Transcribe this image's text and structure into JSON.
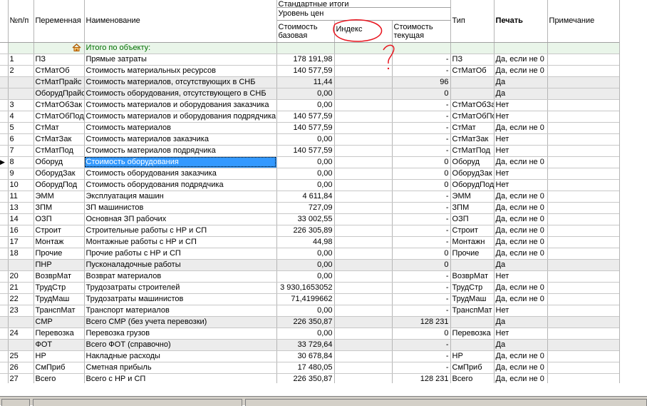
{
  "header": {
    "col_num": "№п/п",
    "col_var": "Переменная",
    "col_name": "Наименование",
    "group_standard": "Стандартные итоги",
    "group_price_level": "Уровень цен",
    "col_base_cost": "Стоимость базовая",
    "col_index": "Индекс",
    "col_current_cost": "Стоимость текущая",
    "col_type": "Тип",
    "col_print": "Печать",
    "col_note": "Примечание"
  },
  "total_row": {
    "label": "Итого по объекту:"
  },
  "rows": [
    {
      "n": "1",
      "var": "ПЗ",
      "name": "Прямые затраты",
      "base": "178 191,98",
      "index": "",
      "cur": "-",
      "type": "ПЗ",
      "print": "Да, если не 0",
      "alt": false
    },
    {
      "n": "2",
      "var": "СтМатОб",
      "name": "Стоимость материальных ресурсов",
      "base": "140 577,59",
      "index": "",
      "cur": "-",
      "type": "СтМатОб",
      "print": "Да, если не 0",
      "alt": false
    },
    {
      "n": "",
      "var": "СтМатПрайс",
      "name": "Стоимость материалов, отсутствующих в СНБ",
      "base": "11,44",
      "index": "",
      "cur": "96",
      "type": "",
      "print": "Да",
      "alt": true
    },
    {
      "n": "",
      "var": "ОборудПрайс",
      "name": "Стоимость оборудования, отсутствующего в СНБ",
      "base": "0,00",
      "index": "",
      "cur": "0",
      "type": "",
      "print": "Да",
      "alt": true
    },
    {
      "n": "3",
      "var": "СтМатОбЗак",
      "name": "Стоимость материалов и оборудования заказчика",
      "base": "0,00",
      "index": "",
      "cur": "-",
      "type": "СтМатОбЗа",
      "print": "Нет",
      "alt": false
    },
    {
      "n": "4",
      "var": "СтМатОбПод",
      "name": "Стоимость материалов и оборудования подрядчика",
      "base": "140 577,59",
      "index": "",
      "cur": "-",
      "type": "СтМатОбПо",
      "print": "Нет",
      "alt": false
    },
    {
      "n": "5",
      "var": "СтМат",
      "name": "Стоимость материалов",
      "base": "140 577,59",
      "index": "",
      "cur": "-",
      "type": "СтМат",
      "print": "Да, если не 0",
      "alt": false
    },
    {
      "n": "6",
      "var": "СтМатЗак",
      "name": "Стоимость материалов заказчика",
      "base": "0,00",
      "index": "",
      "cur": "-",
      "type": "СтМатЗак",
      "print": "Нет",
      "alt": false
    },
    {
      "n": "7",
      "var": "СтМатПод",
      "name": "Стоимость материалов подрядчика",
      "base": "140 577,59",
      "index": "",
      "cur": "-",
      "type": "СтМатПод",
      "print": "Нет",
      "alt": false
    },
    {
      "n": "8",
      "var": "Оборуд",
      "name": "Стоимость оборудования",
      "base": "0,00",
      "index": "",
      "cur": "0",
      "type": "Оборуд",
      "print": "Да, если не 0",
      "alt": false,
      "selected": true
    },
    {
      "n": "9",
      "var": "ОборудЗак",
      "name": "Стоимость оборудования заказчика",
      "base": "0,00",
      "index": "",
      "cur": "0",
      "type": "ОборудЗак",
      "print": "Нет",
      "alt": false
    },
    {
      "n": "10",
      "var": "ОборудПод",
      "name": "Стоимость оборудования подрядчика",
      "base": "0,00",
      "index": "",
      "cur": "0",
      "type": "ОборудПод",
      "print": "Нет",
      "alt": false
    },
    {
      "n": "11",
      "var": "ЭММ",
      "name": "Эксплуатация машин",
      "base": "4 611,84",
      "index": "",
      "cur": "-",
      "type": "ЭММ",
      "print": "Да, если не 0",
      "alt": false
    },
    {
      "n": "13",
      "var": "ЗПМ",
      "name": "ЗП машинистов",
      "base": "727,09",
      "index": "",
      "cur": "-",
      "type": "ЗПМ",
      "print": "Да, если не 0",
      "alt": false
    },
    {
      "n": "14",
      "var": "ОЗП",
      "name": "Основная ЗП рабочих",
      "base": "33 002,55",
      "index": "",
      "cur": "-",
      "type": "ОЗП",
      "print": "Да, если не 0",
      "alt": false
    },
    {
      "n": "16",
      "var": "Строит",
      "name": "Строительные работы с НР и СП",
      "base": "226 305,89",
      "index": "",
      "cur": "-",
      "type": "Строит",
      "print": "Да, если не 0",
      "alt": false
    },
    {
      "n": "17",
      "var": "Монтаж",
      "name": "Монтажные работы с НР и СП",
      "base": "44,98",
      "index": "",
      "cur": "-",
      "type": "Монтажн",
      "print": "Да, если не 0",
      "alt": false
    },
    {
      "n": "18",
      "var": "Прочие",
      "name": "Прочие работы с НР и СП",
      "base": "0,00",
      "index": "",
      "cur": "0",
      "type": "Прочие",
      "print": "Да, если не 0",
      "alt": false
    },
    {
      "n": "",
      "var": "ПНР",
      "name": "Пусконаладочные работы",
      "base": "0,00",
      "index": "",
      "cur": "0",
      "type": "",
      "print": "Да",
      "alt": true
    },
    {
      "n": "20",
      "var": "ВозврМат",
      "name": "Возврат материалов",
      "base": "0,00",
      "index": "",
      "cur": "-",
      "type": "ВозврМат",
      "print": "Нет",
      "alt": false
    },
    {
      "n": "21",
      "var": "ТрудСтр",
      "name": "Трудозатраты строителей",
      "base": "3 930,1653052",
      "index": "",
      "cur": "-",
      "type": "ТрудСтр",
      "print": "Да, если не 0",
      "alt": false
    },
    {
      "n": "22",
      "var": "ТрудМаш",
      "name": "Трудозатраты машинистов",
      "base": "71,4199662",
      "index": "",
      "cur": "-",
      "type": "ТрудМаш",
      "print": "Да, если не 0",
      "alt": false
    },
    {
      "n": "23",
      "var": "ТранспМат",
      "name": "Транспорт материалов",
      "base": "0,00",
      "index": "",
      "cur": "-",
      "type": "ТранспМат",
      "print": "Нет",
      "alt": false
    },
    {
      "n": "",
      "var": "СМР",
      "name": "Всего СМР (без учета перевозки)",
      "base": "226 350,87",
      "index": "",
      "cur": "128 231",
      "type": "",
      "print": "Да",
      "alt": true
    },
    {
      "n": "24",
      "var": "Перевозка",
      "name": "Перевозка грузов",
      "base": "0,00",
      "index": "",
      "cur": "0",
      "type": "Перевозка",
      "print": "Нет",
      "alt": false
    },
    {
      "n": "",
      "var": "ФОТ",
      "name": "Всего ФОТ (справочно)",
      "base": "33 729,64",
      "index": "",
      "cur": "-",
      "type": "",
      "print": "Да",
      "alt": true
    },
    {
      "n": "25",
      "var": "НР",
      "name": "Накладные расходы",
      "base": "30 678,84",
      "index": "",
      "cur": "-",
      "type": "НР",
      "print": "Да, если не 0",
      "alt": false
    },
    {
      "n": "26",
      "var": "СмПриб",
      "name": "Сметная прибыль",
      "base": "17 480,05",
      "index": "",
      "cur": "-",
      "type": "СмПриб",
      "print": "Да, если не 0",
      "alt": false
    },
    {
      "n": "27",
      "var": "Всего",
      "name": "Всего с НР и СП",
      "base": "226 350,87",
      "index": "",
      "cur": "128 231",
      "type": "Всего",
      "print": "Да, если не 0",
      "alt": false
    }
  ],
  "row_pointer": "▶",
  "annotation": {
    "color": "#e8141e",
    "question_mark": "?"
  },
  "colors": {
    "selection": "#3399ff",
    "total_text": "#007000",
    "alt_row": "#ececec"
  },
  "icons": {
    "object_total": "house-icon",
    "row_pointer": "current-row-pointer-icon"
  }
}
